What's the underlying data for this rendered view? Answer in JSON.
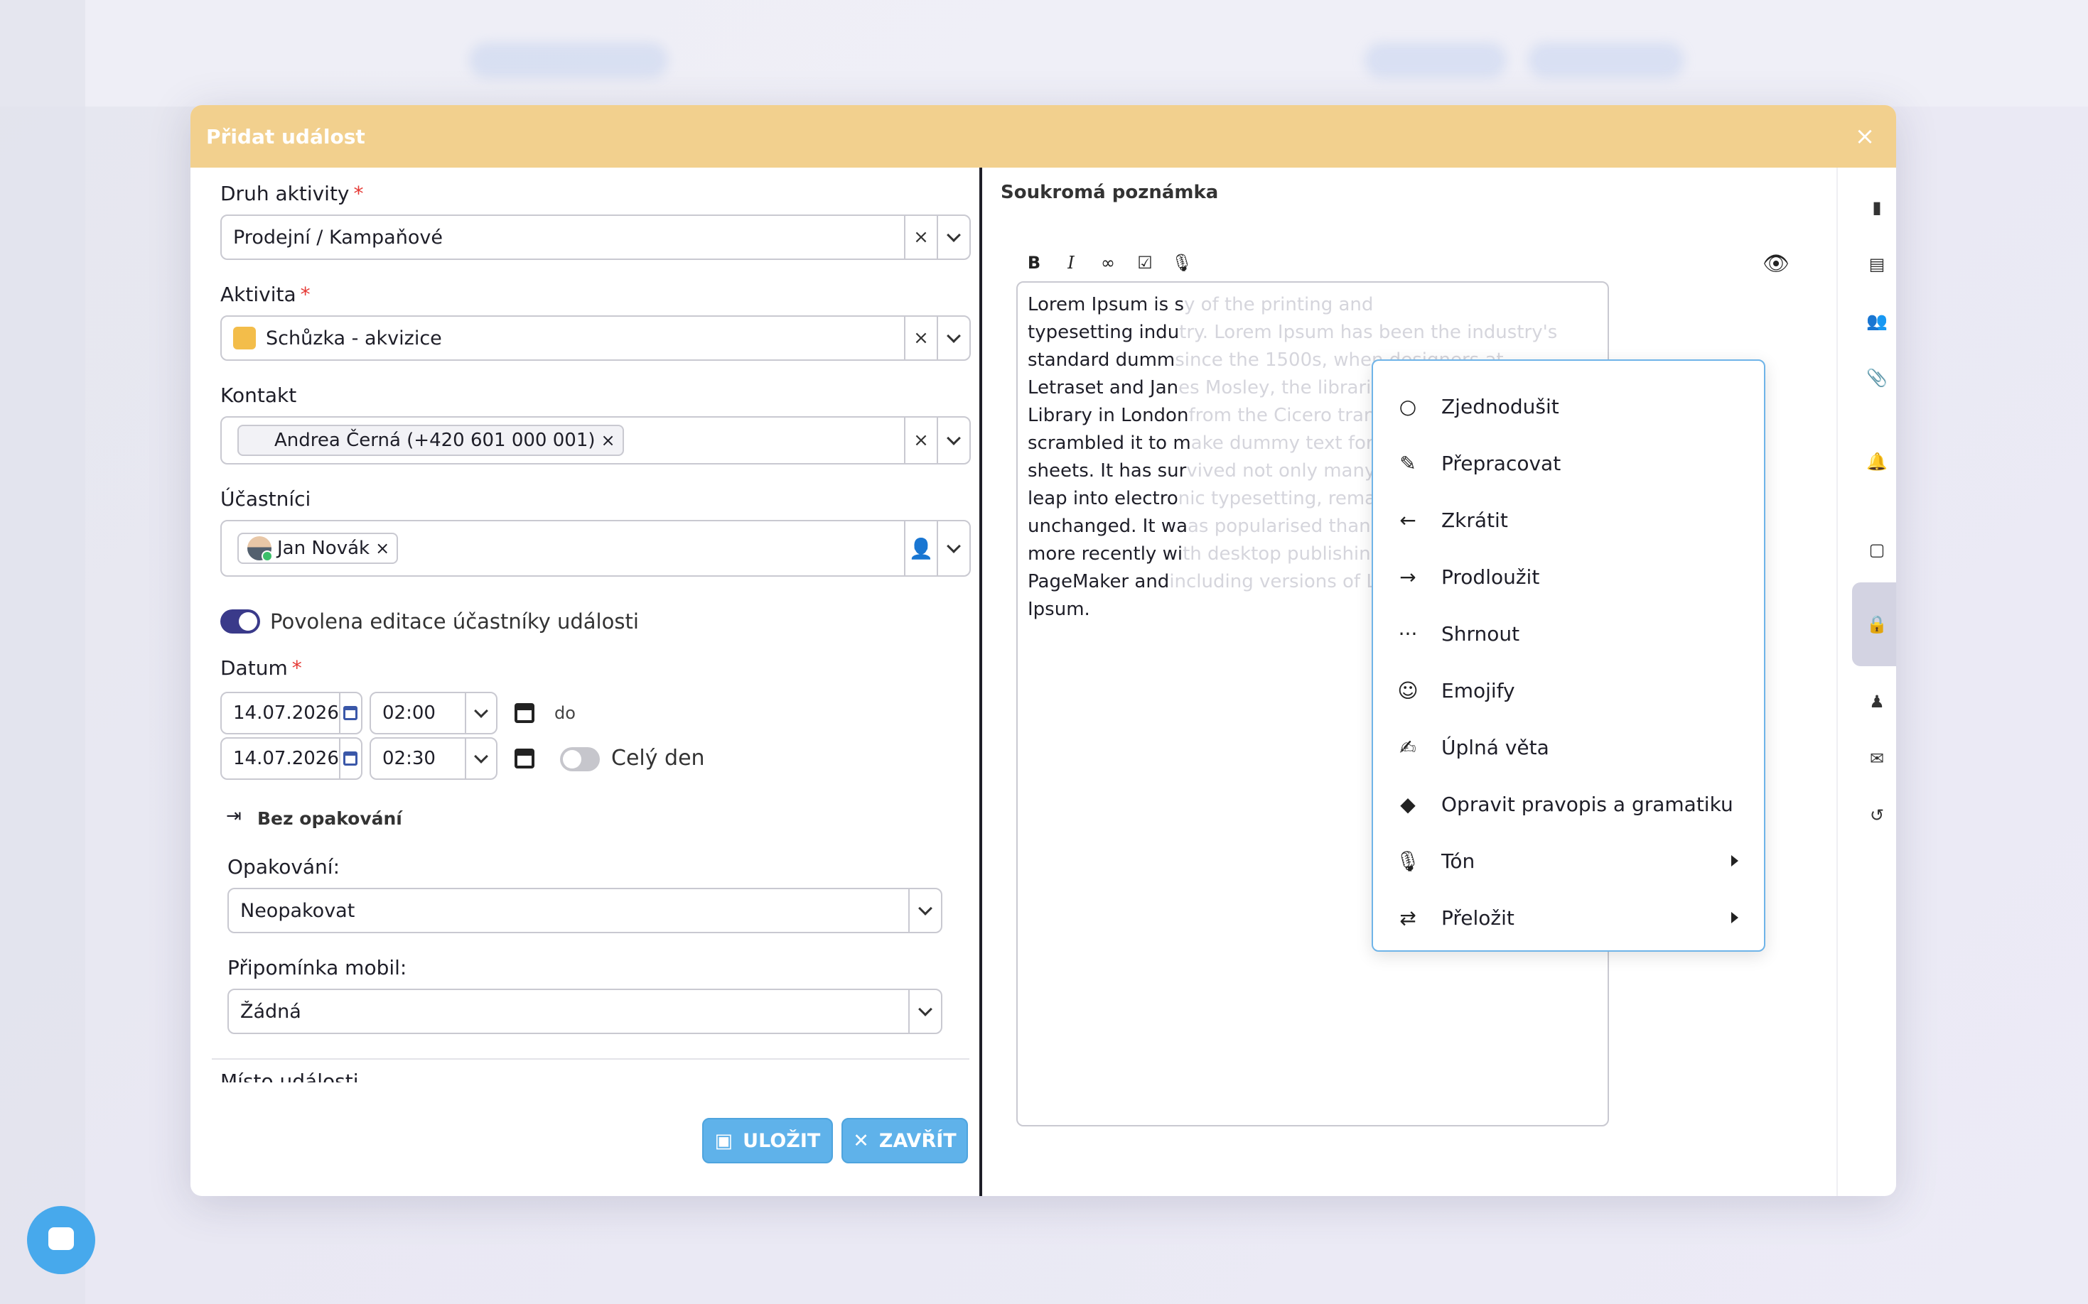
{
  "modal": {
    "title": "Přidat událost",
    "close_glyph": "×"
  },
  "form": {
    "activity_type": {
      "label": "Druh aktivity",
      "value": "Prodejní / Kampaňové"
    },
    "activity": {
      "label": "Aktivita",
      "value": "Schůzka - akvizice",
      "color": "#f3bd4a"
    },
    "contact": {
      "label": "Kontakt",
      "chip": "Andrea Černá (+420 601 000 001)"
    },
    "participants": {
      "label": "Účastníci",
      "chip": "Jan Novák"
    },
    "edit_toggle": {
      "label": "Povolena editace účastníky události",
      "on": true
    },
    "date": {
      "label": "Datum",
      "start_date": "14.07.2026",
      "start_time": "02:00",
      "to_label": "do",
      "end_date": "14.07.2026",
      "end_time": "02:30",
      "all_day_label": "Celý den",
      "all_day_on": false
    },
    "repeat_summary": "Bez opakování",
    "repeat": {
      "label": "Opakování:",
      "value": "Neopakovat"
    },
    "mobile_reminder": {
      "label": "Připomínka mobil:",
      "value": "Žádná"
    },
    "cut_label": "Místo události",
    "required_mark": "*",
    "save_label": "ULOŽIT",
    "close_label": "ZAVŘÍT"
  },
  "note": {
    "title": "Soukromá poznámka",
    "visible_text": [
      "Lorem Ipsum is s",
      "typesetting indu",
      "standard dumm",
      "Letraset and Jan",
      "Library in London",
      "scrambled it to m",
      "sheets. It has sur",
      "leap into electro",
      "unchanged. It wa",
      "more recently wi",
      "PageMaker and",
      "Ipsum."
    ],
    "faded_text": [
      "y of the printing and",
      "try. Lorem Ipsum has been the industry's",
      "since the 1500s, when designers at",
      "es Mosley, the librarian at St Bride Printing",
      "from the Cicero translation and",
      "ake dummy text for Letraset's Body Type",
      "vived not only many decades, but also the",
      "nic typesetting, remaining essentially",
      "as popularised thanks to these sheets and",
      "th desktop publishing software like Aldus",
      "including versions of Lorem",
      ""
    ]
  },
  "ai_menu": [
    {
      "label": "Zjednodušit",
      "icon": "circle-icon",
      "glyph": "○",
      "submenu": false
    },
    {
      "label": "Přepracovat",
      "icon": "pencil-icon",
      "glyph": "✎",
      "submenu": false
    },
    {
      "label": "Zkrátit",
      "icon": "arrow-left-icon",
      "glyph": "←",
      "submenu": false
    },
    {
      "label": "Prodloužit",
      "icon": "arrow-right-icon",
      "glyph": "→",
      "submenu": false
    },
    {
      "label": "Shrnout",
      "icon": "ellipsis-icon",
      "glyph": "···",
      "submenu": false
    },
    {
      "label": "Emojify",
      "icon": "smiley-icon",
      "glyph": "☺",
      "submenu": false
    },
    {
      "label": "Úplná věta",
      "icon": "signature-icon",
      "glyph": "✍",
      "submenu": false
    },
    {
      "label": "Opravit pravopis a gramatiku",
      "icon": "eraser-icon",
      "glyph": "◆",
      "submenu": false
    },
    {
      "label": "Tón",
      "icon": "microphone-icon",
      "glyph": "🎙",
      "submenu": true
    },
    {
      "label": "Přeložit",
      "icon": "translate-icon",
      "glyph": "⇄",
      "submenu": true
    }
  ],
  "sidebar": [
    {
      "label": "Poznámka",
      "icon": "book-icon",
      "glyph": "▮",
      "active": false
    },
    {
      "label": "Vlastní pole",
      "icon": "table-icon",
      "glyph": "▤",
      "active": false
    },
    {
      "label": "Účastníci",
      "icon": "users-icon",
      "glyph": "👥",
      "active": false
    },
    {
      "label": "Dokumenty",
      "icon": "paperclip-icon",
      "glyph": "📎",
      "active": false
    },
    {
      "label": "Potvrzení a připomínky kontaktům",
      "icon": "bell-icon",
      "glyph": "🔔",
      "active": false
    },
    {
      "label": "Historie kontaktu",
      "icon": "note-icon",
      "glyph": "▢",
      "active": false
    },
    {
      "label": "Soukromá poznámka",
      "icon": "lock-icon",
      "glyph": "🔒",
      "active": true
    },
    {
      "label": "Rezervace",
      "icon": "reservation-icon",
      "glyph": "♟",
      "active": false
    },
    {
      "label": "E-maily",
      "icon": "envelope-icon",
      "glyph": "✉",
      "active": false
    },
    {
      "label": "Operace",
      "icon": "history-icon",
      "glyph": "↺",
      "active": false
    }
  ],
  "colors": {
    "header": "#f2d08e",
    "primary_button": "#5fb2ea",
    "active_nav": "#d3d3e2",
    "accent": "#3a3a8a"
  }
}
